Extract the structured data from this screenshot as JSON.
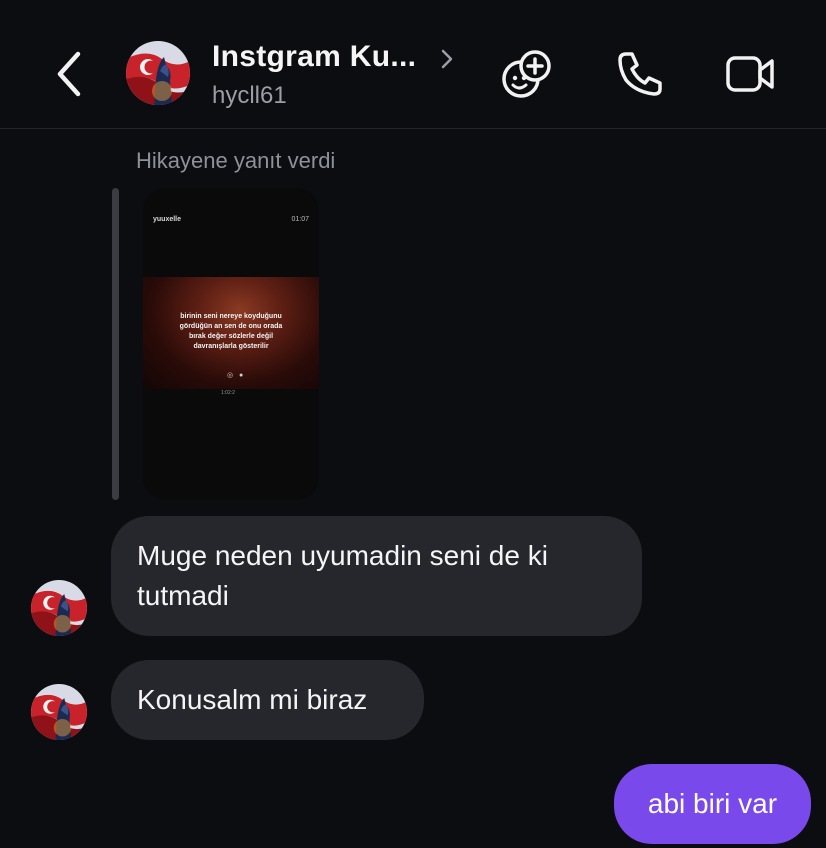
{
  "header": {
    "title": "Instgram Ku...",
    "subtitle": "hycll61",
    "back_icon": "chevron-left-icon",
    "title_chevron_icon": "chevron-right-icon",
    "actions": [
      {
        "name": "add-people-button",
        "icon": "smile-plus-icon"
      },
      {
        "name": "voice-call-button",
        "icon": "phone-icon"
      },
      {
        "name": "video-call-button",
        "icon": "video-camera-icon"
      }
    ]
  },
  "story_reply": {
    "caption": "Hikayene yanıt verdi",
    "story": {
      "username": "yuuxelle",
      "time": "01:07",
      "text": "birinin seni nereye koyduğunu gördüğün an sen de onu orada bırak değer sözlerle değil davranışlarla gösterilir",
      "dots": "◎ ●",
      "sub": "1:02:2"
    }
  },
  "messages": [
    {
      "direction": "incoming",
      "text": "Muge neden uyumadin seni de ki tutmadi"
    },
    {
      "direction": "incoming",
      "text": "Konusalm mi biraz"
    },
    {
      "direction": "outgoing",
      "text": "abi biri var"
    }
  ],
  "colors": {
    "background": "#0c0d11",
    "incoming_bubble": "#25272d",
    "outgoing_bubble": "#7a49ec",
    "muted_text": "#9b9ea5"
  }
}
